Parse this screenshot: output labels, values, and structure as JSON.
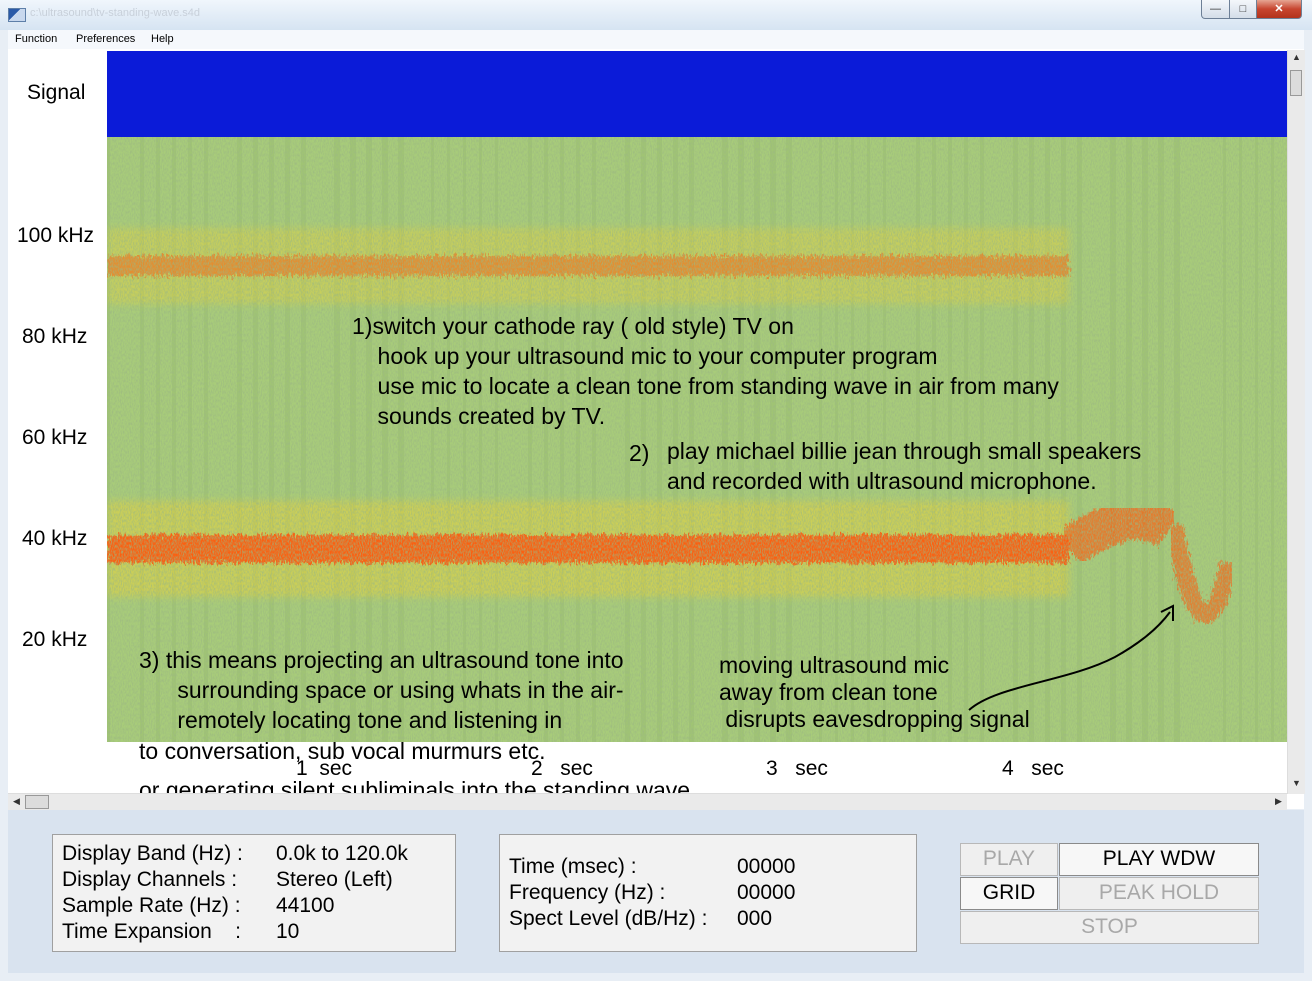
{
  "window": {
    "title": "c:\\ultrasound\\tv-standing-wave.s4d"
  },
  "menu": [
    "Function",
    "Preferences",
    "Help"
  ],
  "signal_label": "Signal",
  "y_labels": [
    "100 kHz",
    "80 kHz",
    "60 kHz",
    "40 kHz",
    "20 kHz"
  ],
  "x_ticks": [
    {
      "num": "1",
      "unit": "sec"
    },
    {
      "num": "2",
      "unit": "sec"
    },
    {
      "num": "3",
      "unit": "sec"
    },
    {
      "num": "4",
      "unit": "sec"
    }
  ],
  "annotations": {
    "block1": "1)switch your cathode ray ( old style) TV on\n    hook up your ultrasound mic to your computer program\n    use mic to locate a clean tone from standing wave in air from many\n    sounds created by TV.",
    "block2_num": "2)",
    "block2": "play michael billie jean through small speakers\nand recorded with ultrasound microphone.",
    "block3": "3) this means projecting an ultrasound tone into\n      surrounding space or using whats in the air-\n      remotely locating tone and listening in",
    "block3_tail1": "to conversation, sub vocal murmurs etc.",
    "block3_tail2": "or generating silent subliminals into the standing wave.",
    "moving": "moving ultrasound mic\naway from clean tone\n disrupts eavesdropping signal"
  },
  "info": {
    "rows": [
      {
        "label": "Display Band (Hz) :",
        "value": "0.0k to 120.0k"
      },
      {
        "label": "Display Channels :",
        "value": "Stereo (Left)"
      },
      {
        "label": "Sample Rate (Hz) :",
        "value": "44100"
      },
      {
        "label": "Time Expansion    :",
        "value": "10"
      }
    ]
  },
  "cursor": {
    "rows": [
      {
        "label": "Time (msec) :",
        "value": "00000"
      },
      {
        "label": "Frequency (Hz) :",
        "value": "00000"
      },
      {
        "label": "Spect Level (dB/Hz) :",
        "value": "000"
      }
    ]
  },
  "buttons": {
    "play": "PLAY",
    "play_wdw": "PLAY WDW",
    "grid": "GRID",
    "peak_hold": "PEAK HOLD",
    "stop": "STOP"
  },
  "chart_data": {
    "type": "heatmap",
    "xlabel": "",
    "ylabel": "",
    "x_ticks": [
      1,
      2,
      3,
      4
    ],
    "y_ticks_khz": [
      20,
      40,
      60,
      80,
      100
    ],
    "ylim_khz": [
      0,
      120
    ],
    "colors": {
      "background": "#a8cc7a",
      "noise": "#7fa05a",
      "mid": "#e8d23a",
      "high": "#ff5a10",
      "signal_band": "#0b1bd8"
    },
    "bands": [
      {
        "freq_khz": 94,
        "end_sec": 4.2,
        "intensity": "medium"
      },
      {
        "freq_khz": 33,
        "end_sec": 4.2,
        "intensity": "high"
      }
    ]
  }
}
